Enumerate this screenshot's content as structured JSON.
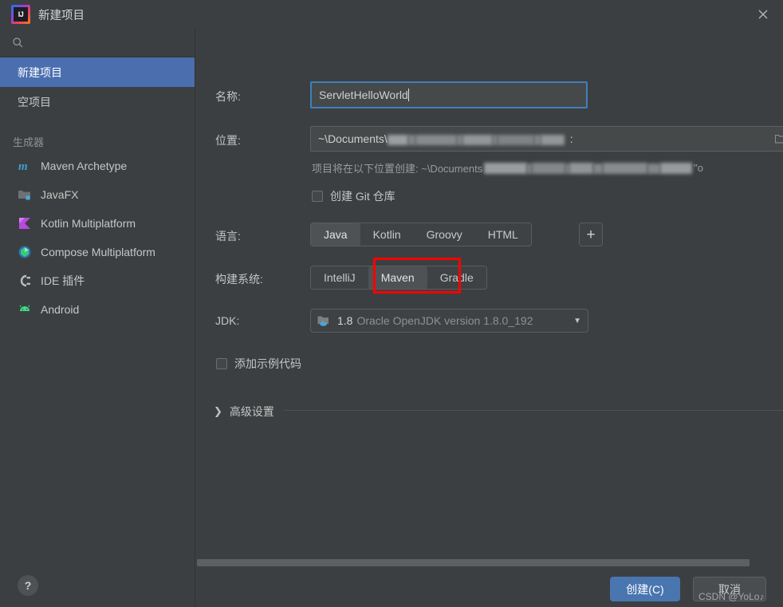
{
  "window": {
    "title": "新建项目",
    "logo_icon": "intellij-idea-logo",
    "close_icon": "close-icon"
  },
  "sidebar": {
    "search": {
      "placeholder": "",
      "value": "",
      "icon": "search-icon"
    },
    "nav_items": [
      {
        "label": "新建项目",
        "selected": true
      },
      {
        "label": "空项目",
        "selected": false
      }
    ],
    "generators_label": "生成器",
    "generators": [
      {
        "label": "Maven Archetype",
        "icon": "maven-icon"
      },
      {
        "label": "JavaFX",
        "icon": "javafx-folder-icon"
      },
      {
        "label": "Kotlin Multiplatform",
        "icon": "kotlin-icon"
      },
      {
        "label": "Compose Multiplatform",
        "icon": "compose-icon"
      },
      {
        "label": "IDE 插件",
        "icon": "plugin-icon"
      },
      {
        "label": "Android",
        "icon": "android-icon"
      }
    ],
    "help_button": "?"
  },
  "form": {
    "name": {
      "label": "名称:",
      "value": "ServletHelloWorld",
      "focused": true
    },
    "location": {
      "label": "位置:",
      "value_prefix": "~\\Documents\\",
      "value_suffix": ":",
      "redacted": true,
      "browse_icon": "folder-browse-icon"
    },
    "location_hint": {
      "prefix": "项目将在以下位置创建: ~\\Documents",
      "suffix": "\"o",
      "redacted": true
    },
    "git_checkbox": {
      "label": "创建 Git 仓库",
      "checked": false
    },
    "language": {
      "label": "语言:",
      "options": [
        "Java",
        "Kotlin",
        "Groovy",
        "HTML"
      ],
      "selected": "Java",
      "add_button": "+"
    },
    "build_system": {
      "label": "构建系统:",
      "options": [
        "IntelliJ",
        "Maven",
        "Gradle"
      ],
      "selected": "Maven",
      "annotated": "Maven"
    },
    "jdk": {
      "label": "JDK:",
      "version": "1.8",
      "description": "Oracle OpenJDK version 1.8.0_192",
      "icon": "jdk-folder-icon",
      "dropdown_icon": "chevron-down-icon"
    },
    "sample_code_checkbox": {
      "label": "添加示例代码",
      "checked": false
    },
    "advanced": {
      "label": "高级设置",
      "expanded": false,
      "icon": "chevron-right-icon"
    }
  },
  "footer": {
    "create_button": "创建(C)",
    "cancel_button": "取消"
  },
  "watermark": "CSDN @YoLo♪",
  "colors": {
    "background": "#3c3f41",
    "selection_blue": "#4b6eaf",
    "primary_button": "#4a76b0",
    "focus_border": "#3f7fbf",
    "annotation_red": "#ff0000"
  }
}
